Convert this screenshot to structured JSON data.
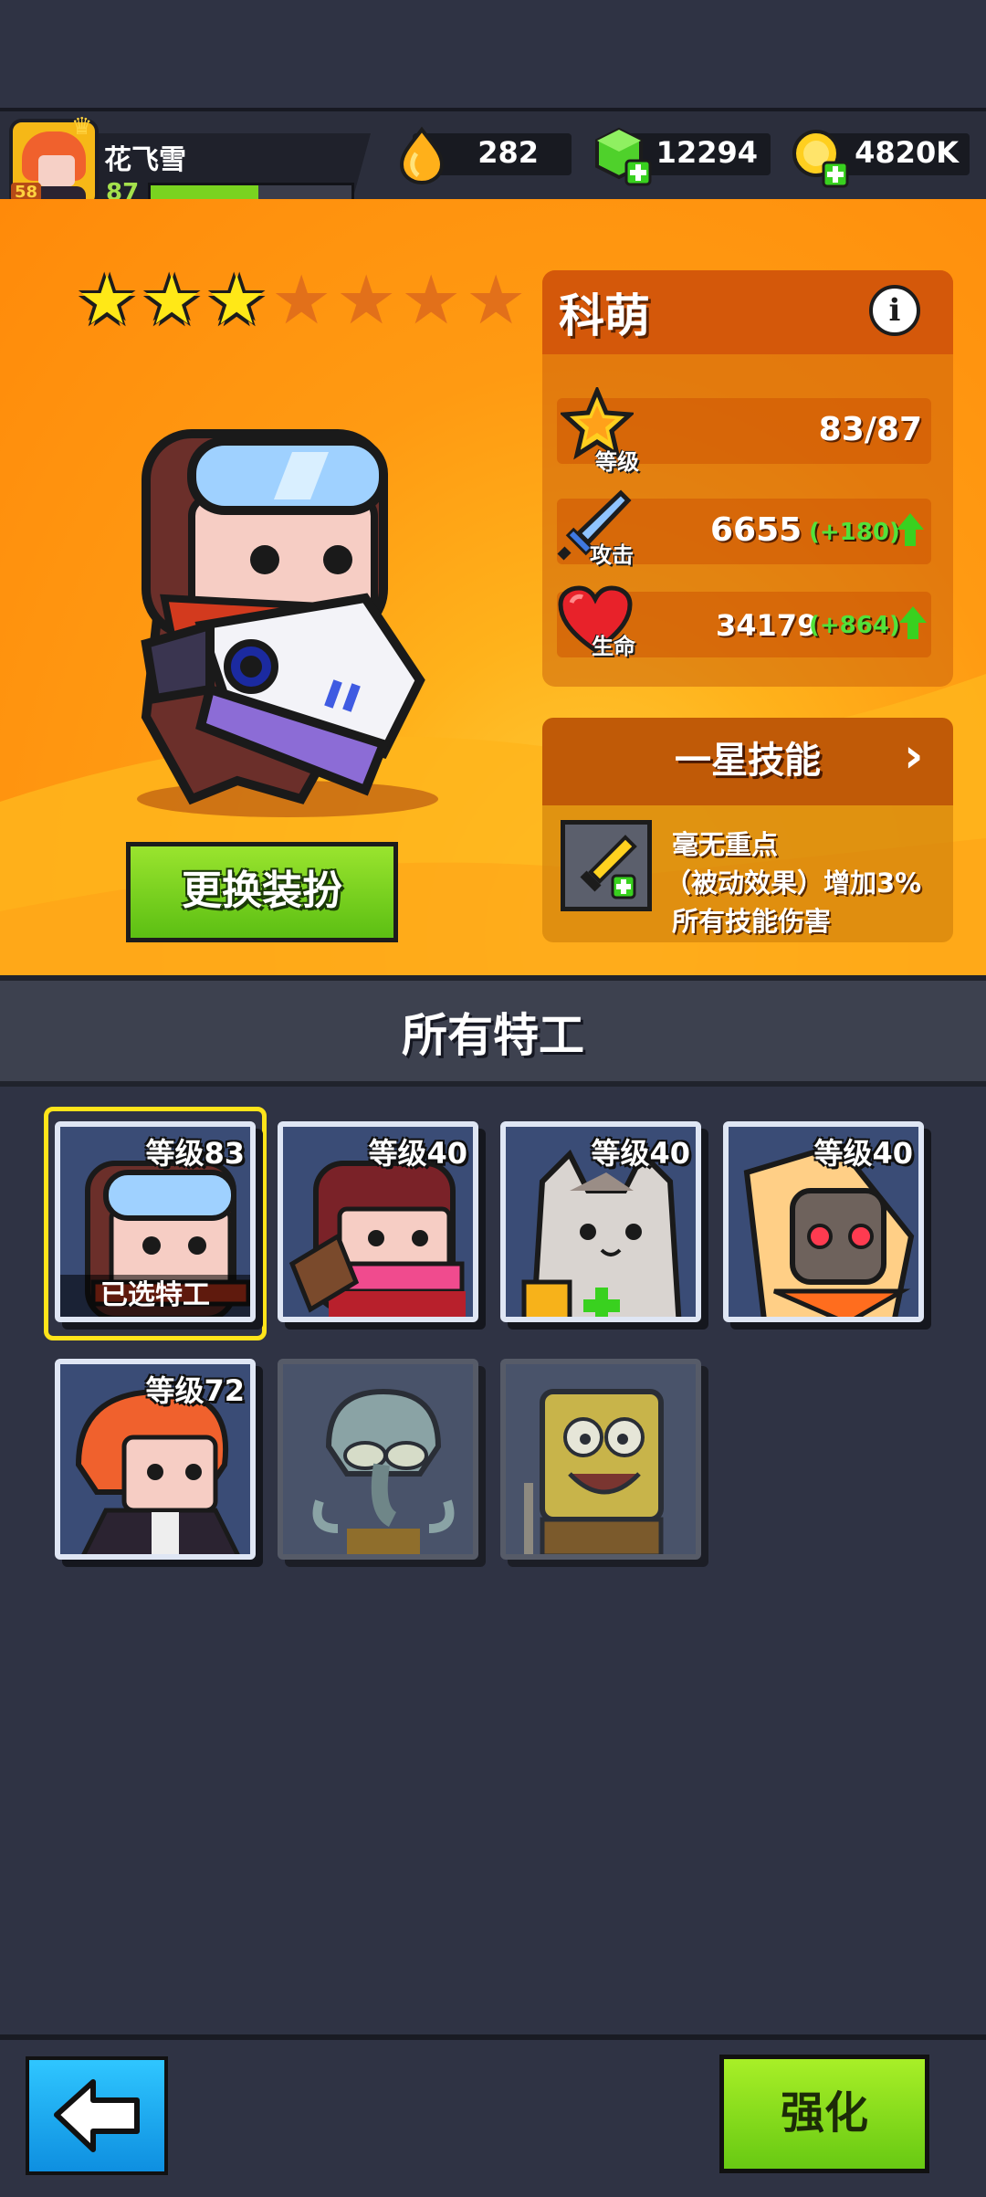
{
  "player": {
    "name": "花飞雪",
    "avatar_level": "58",
    "level": "87",
    "xp_fraction": 0.55
  },
  "currencies": [
    {
      "icon": "fire-drop-icon",
      "value": "282"
    },
    {
      "icon": "green-gem-icon",
      "value": "12294"
    },
    {
      "icon": "gold-coin-icon",
      "value": "4820K"
    }
  ],
  "hero": {
    "stars_filled": 3,
    "stars_total": 7,
    "name": "科萌",
    "change_skin_label": "更换装扮"
  },
  "stats": {
    "level": {
      "label": "等级",
      "value": "83/87"
    },
    "attack": {
      "label": "攻击",
      "value": "6655",
      "bonus": "(+180)"
    },
    "hp": {
      "label": "生命",
      "value": "34179",
      "bonus": "(+864)"
    }
  },
  "skill": {
    "title": "一星技能",
    "lines": [
      "毫无重点",
      "（被动效果）增加3%",
      "所有技能伤害"
    ]
  },
  "section_title": "所有特工",
  "agents": [
    {
      "level": "等级83",
      "selected_label": "已选特工",
      "selected": true,
      "locked": false
    },
    {
      "level": "等级40",
      "selected": false,
      "locked": false
    },
    {
      "level": "等级40",
      "selected": false,
      "locked": false
    },
    {
      "level": "等级40",
      "selected": false,
      "locked": false
    },
    {
      "level": "等级72",
      "selected": false,
      "locked": false
    },
    {
      "level": "",
      "selected": false,
      "locked": true
    },
    {
      "level": "",
      "selected": false,
      "locked": true
    }
  ],
  "bottom": {
    "upgrade_label": "强化"
  },
  "colors": {
    "accent_orange": "#ff9a12",
    "button_green": "#79d320",
    "back_blue": "#1aa9f0",
    "selected_yellow": "#ffe41a"
  }
}
